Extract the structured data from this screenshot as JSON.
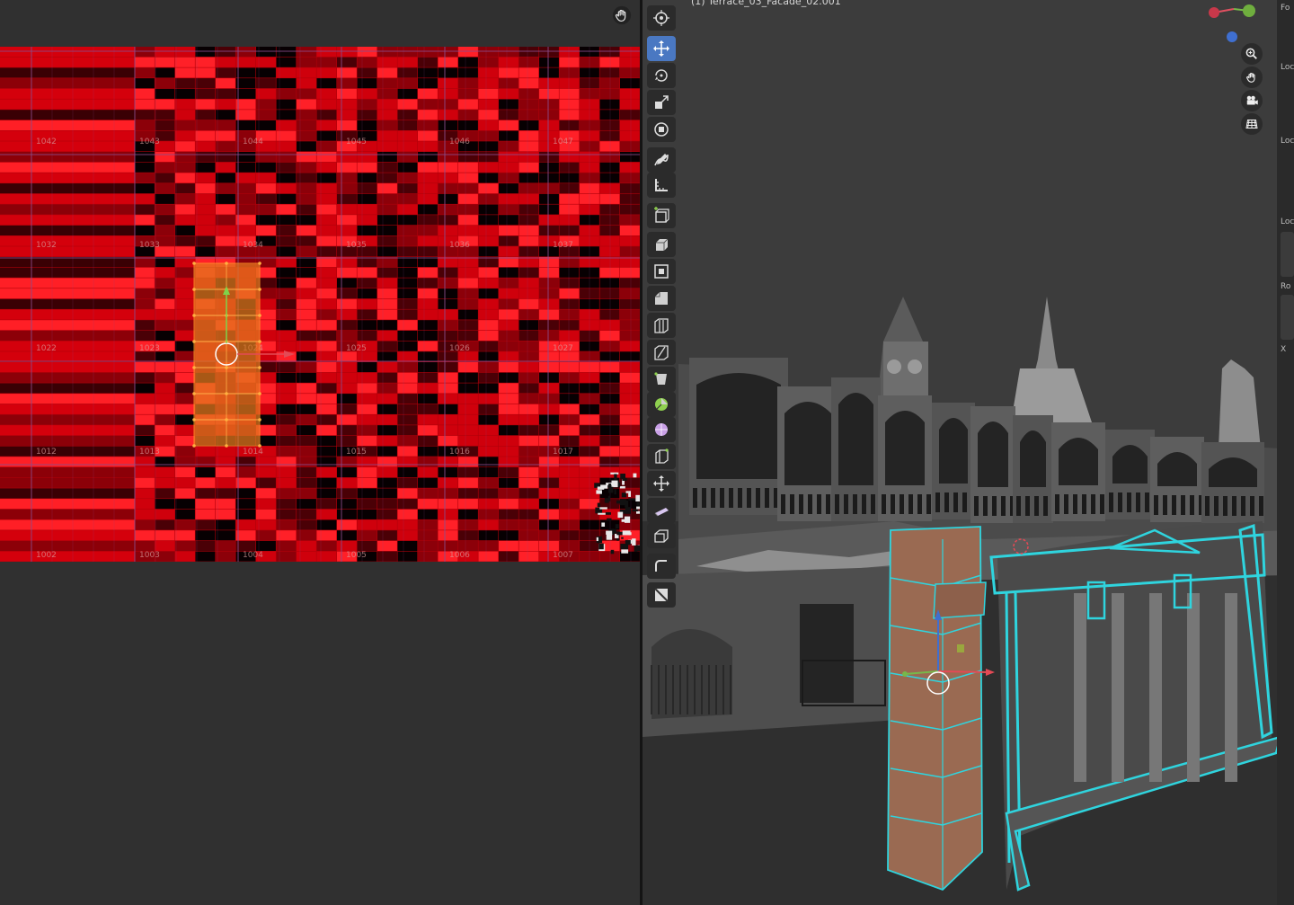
{
  "uv_editor": {
    "tile_rows": [
      [
        "1042",
        "1043",
        "1044",
        "1045",
        "1046",
        "1047"
      ],
      [
        "1032",
        "1033",
        "1034",
        "1035",
        "1036",
        "1037"
      ],
      [
        "1022",
        "1023",
        "1024",
        "1025",
        "1026",
        "1027"
      ],
      [
        "1012",
        "1013",
        "1014",
        "1015",
        "1016",
        "1017"
      ],
      [
        "1002",
        "1003",
        "1004",
        "1005",
        "1006",
        "1007"
      ]
    ],
    "colors": {
      "texture_base": "#c1000a",
      "selection": "#e67a1e",
      "grid": "#8a4d8c"
    }
  },
  "viewport": {
    "title": "(1) Terrace_03_Facade_02.001",
    "tools": [
      {
        "icon": "cursor-icon"
      },
      {
        "icon": "move-icon",
        "active": true
      },
      {
        "icon": "rotate-icon"
      },
      {
        "icon": "scale-icon"
      },
      {
        "icon": "transform-icon"
      },
      {
        "icon": "annotate-icon"
      },
      {
        "icon": "measure-icon"
      },
      {
        "icon": "add-cube-icon"
      },
      {
        "icon": "extrude-icon"
      },
      {
        "icon": "inset-icon"
      },
      {
        "icon": "bevel-icon"
      },
      {
        "icon": "loop-cut-icon"
      },
      {
        "icon": "knife-icon"
      },
      {
        "icon": "poly-build-icon"
      },
      {
        "icon": "spin-icon"
      },
      {
        "icon": "smooth-icon"
      },
      {
        "icon": "edge-slide-icon"
      },
      {
        "icon": "shrink-fatten-icon"
      },
      {
        "icon": "shear-icon"
      },
      {
        "icon": "rip-icon"
      },
      {
        "icon": "extra-tool-icon"
      },
      {
        "icon": "extra-tool-2-icon"
      }
    ],
    "nav_buttons": [
      "zoom-icon",
      "pan-hand-icon",
      "camera-icon",
      "grid-view-icon"
    ],
    "colors": {
      "accent": "#4a78c2",
      "wire": "#2fd4de",
      "brick": "#9a6a52"
    }
  },
  "sidebar": {
    "labels": [
      "Fo",
      "Loc",
      "Loc",
      "Loc",
      "Ro",
      "X"
    ]
  }
}
